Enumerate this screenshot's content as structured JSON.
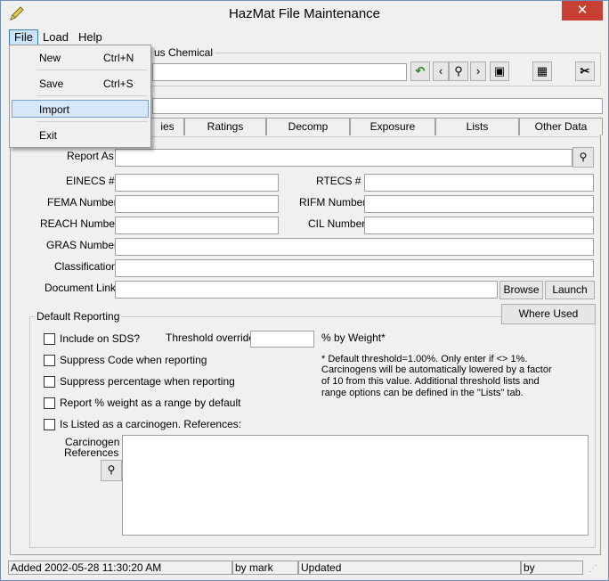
{
  "window": {
    "title": "HazMat File Maintenance",
    "close": "✕"
  },
  "menubar": {
    "file": "File",
    "load": "Load",
    "help": "Help"
  },
  "file_menu": [
    {
      "label": "New",
      "shortcut": "Ctrl+N"
    },
    {
      "label": "Save",
      "shortcut": "Ctrl+S"
    },
    {
      "label": "Import",
      "shortcut": ""
    },
    {
      "label": "Exit",
      "shortcut": ""
    }
  ],
  "chemical_group": {
    "label_fragment": "us Chemical"
  },
  "tabs": [
    "ies",
    "Ratings",
    "Decomp",
    "Exposure",
    "Lists",
    "Other Data"
  ],
  "fields": {
    "report_as": "Report As",
    "einecs": "EINECS #",
    "rtecs": "RTECS #",
    "fema": "FEMA Number",
    "rifm": "RIFM Number",
    "reach": "REACH Number",
    "cil": "CIL Number",
    "gras": "GRAS Number",
    "classification": "Classification",
    "doc_link": "Document Link"
  },
  "buttons": {
    "browse": "Browse",
    "launch": "Launch",
    "where_used": "Where Used"
  },
  "default_reporting": {
    "title": "Default Reporting",
    "include_sds": "Include on SDS?",
    "threshold_override": "Threshold override",
    "pct_weight": "% by Weight*",
    "suppress_code": "Suppress Code when reporting",
    "suppress_pct": "Suppress percentage when reporting",
    "report_range": "Report % weight as a range by default",
    "carcinogen": "Is Listed as a carcinogen.  References:",
    "note_1": "* Default threshold=1.00%.  Only enter if <> 1%.",
    "note_2": "Carcinogens will be automatically lowered by a factor",
    "note_3": "of 10 from this value.  Additional threshold lists and",
    "note_4": "range options can be defined in the \"Lists\" tab.",
    "carc_ref_1": "Carcinogen",
    "carc_ref_2": "References"
  },
  "status": {
    "added": "Added 2002-05-28 11:30:20 AM",
    "by_added": "by mark",
    "updated": "Updated",
    "by_updated": "by"
  }
}
